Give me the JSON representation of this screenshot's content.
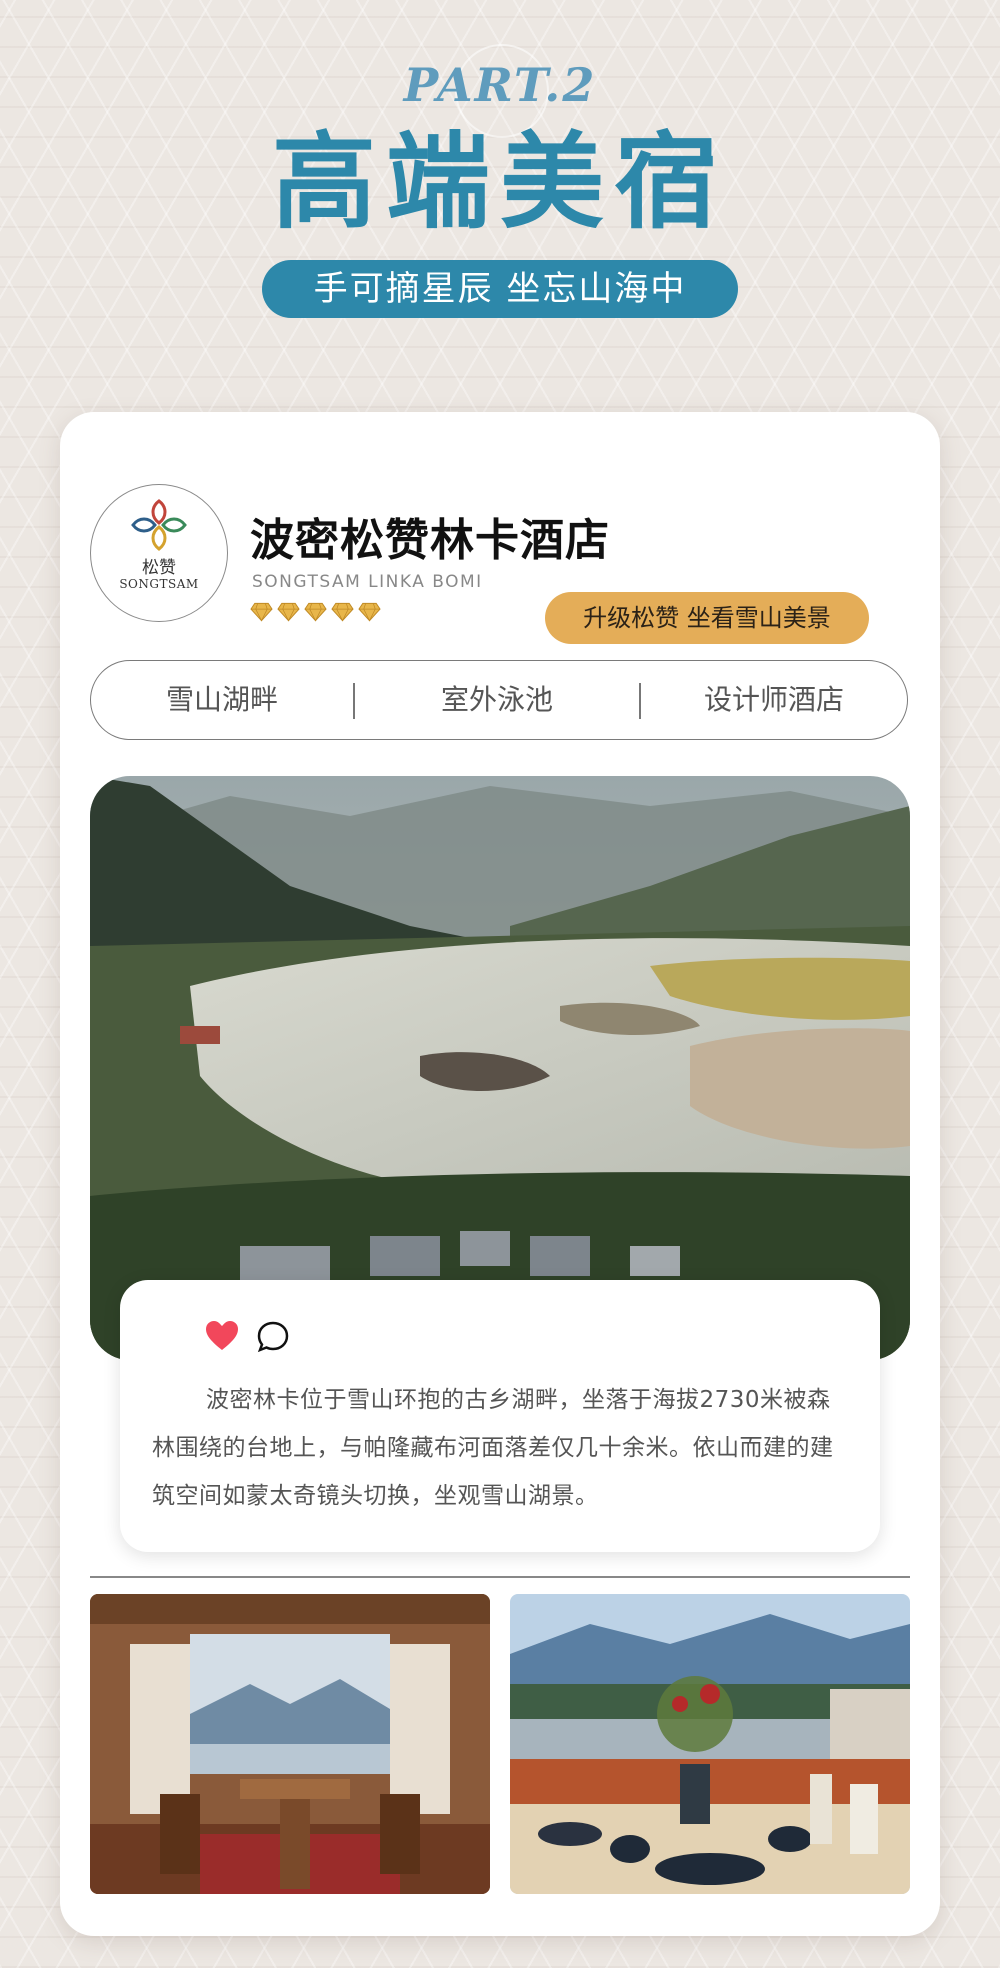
{
  "header": {
    "part_label": "PART.2",
    "title": "高端美宿",
    "subtitle": "手可摘星辰 坐忘山海中"
  },
  "hotel": {
    "logo_cn": "松赞",
    "logo_en": "SONGTSAM",
    "name": "波密松赞林卡酒店",
    "name_en": "SONGTSAM LINKA BOMI",
    "diamond_rating": 5,
    "upgrade_label": "升级松赞 坐看雪山美景",
    "tags": [
      "雪山湖畔",
      "室外泳池",
      "设计师酒店"
    ],
    "description": "波密林卡位于雪山环抱的古乡湖畔，坐落于海拔2730米被森林围绕的台地上，与帕隆藏布河面落差仅几十余米。依山而建的建筑空间如蒙太奇镜头切换，坐观雪山湖景。"
  },
  "colors": {
    "brand_blue": "#2d88aa",
    "part_blue": "#5f9cbd",
    "gold": "#e4ad58",
    "heart_red": "#f2475b"
  },
  "icons": {
    "like": "heart-icon",
    "comment": "comment-icon",
    "rating": "diamond-icon"
  }
}
